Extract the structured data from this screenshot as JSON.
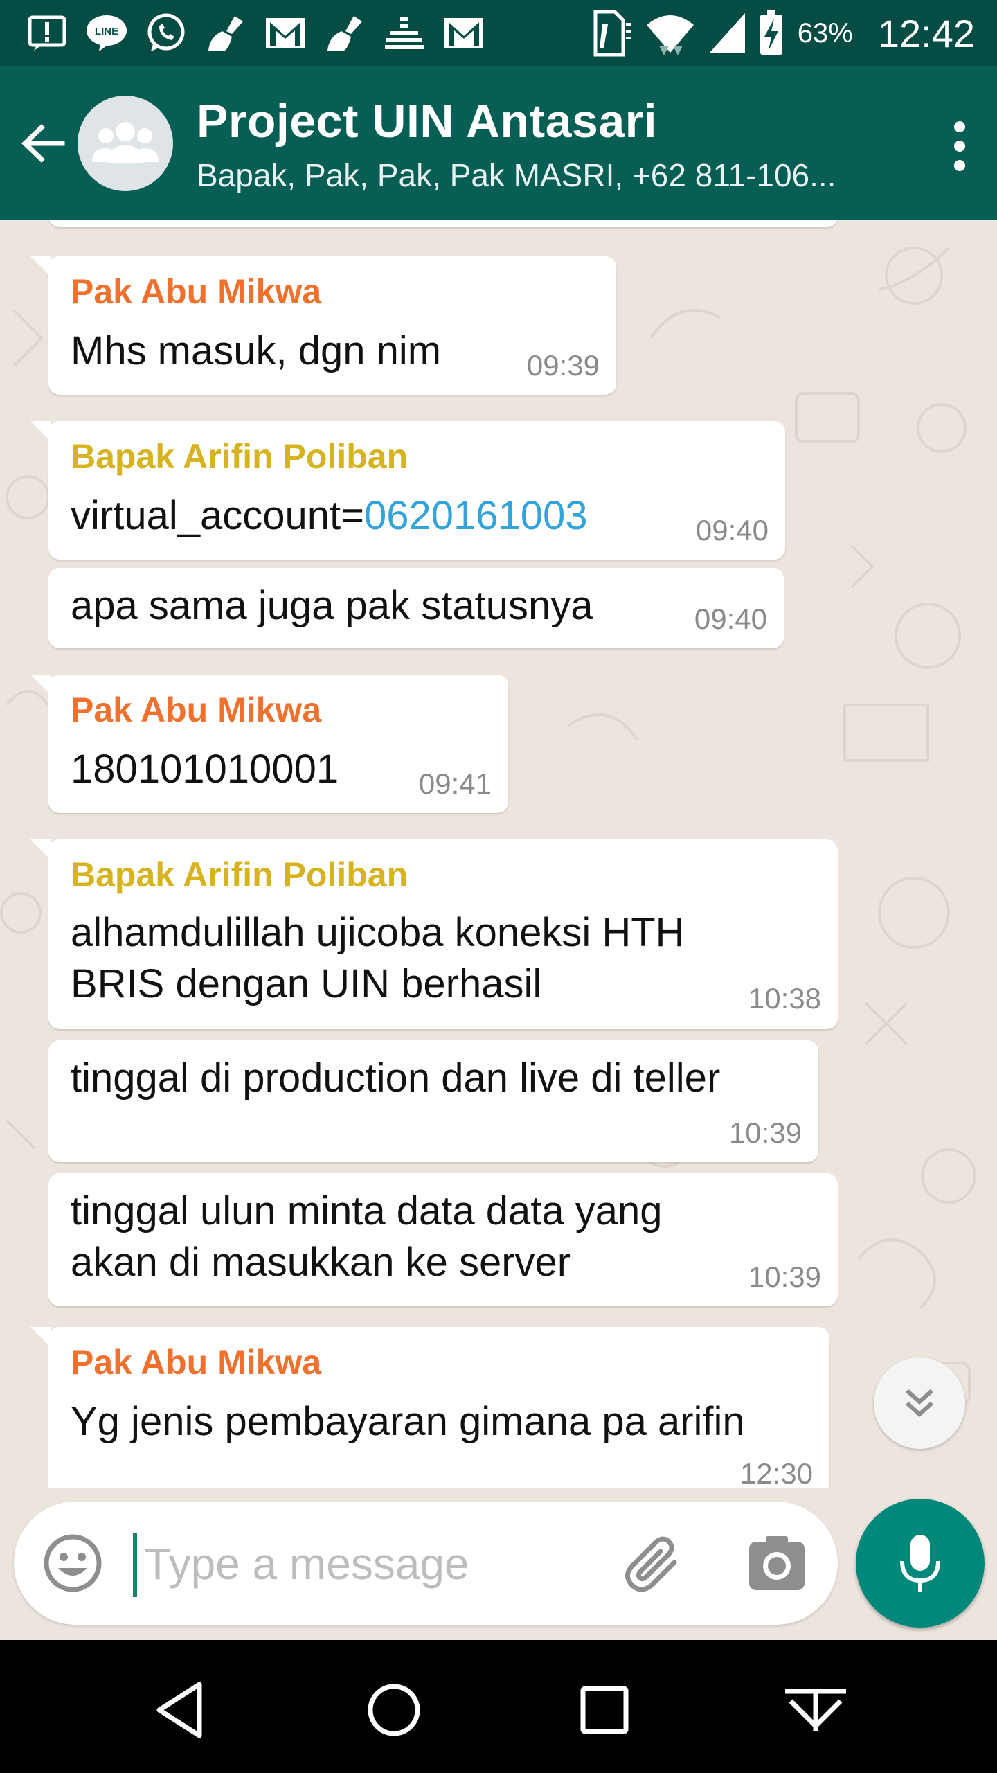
{
  "status_bar": {
    "icons": [
      "alert-icon",
      "line-app-icon",
      "whatsapp-icon",
      "cleaner-icon",
      "gmail-icon",
      "cleaner-icon",
      "equalizer-icon",
      "gmail-icon",
      "sim-icon",
      "wifi-icon",
      "signal-icon",
      "battery-charging-icon"
    ],
    "battery": "63%",
    "time": "12:42"
  },
  "header": {
    "title": "Project UIN Antasari",
    "subtitle": "Bapak, Pak, Pak, Pak MASRI, +62 811-106..."
  },
  "messages": [
    {
      "sender": "Pak Abu Mikwa",
      "lines": [
        "Mhs masuk, dgn nim"
      ],
      "time": "09:39"
    },
    {
      "sender": "Bapak Arifin Poliban",
      "prefix": "virtual_account=",
      "link": "0620161003",
      "time": "09:40"
    },
    {
      "lines": [
        "apa sama juga pak statusnya"
      ],
      "time": "09:40"
    },
    {
      "sender": "Pak Abu Mikwa",
      "lines": [
        "180101010001"
      ],
      "time": "09:41"
    },
    {
      "sender": "Bapak Arifin Poliban",
      "lines": [
        "alhamdulillah ujicoba koneksi HTH",
        "BRIS dengan  UIN berhasil"
      ],
      "time": "10:38"
    },
    {
      "lines": [
        "tinggal di production dan live di teller"
      ],
      "time": "10:39"
    },
    {
      "lines": [
        "tinggal ulun minta data data yang",
        "akan di masukkan ke server"
      ],
      "time": "10:39"
    },
    {
      "sender": "Pak Abu Mikwa",
      "lines": [
        "Yg jenis pembayaran gimana pa arifin"
      ],
      "time": "12:30"
    }
  ],
  "input": {
    "placeholder": "Type a message"
  },
  "colors": {
    "header": "#075e54",
    "status_bar": "#054d44",
    "sender_abu": "#f0712e",
    "sender_arifin": "#d6b31f",
    "link": "#32a3db",
    "mic": "#00897b",
    "wallpaper": "#ece5dd"
  }
}
